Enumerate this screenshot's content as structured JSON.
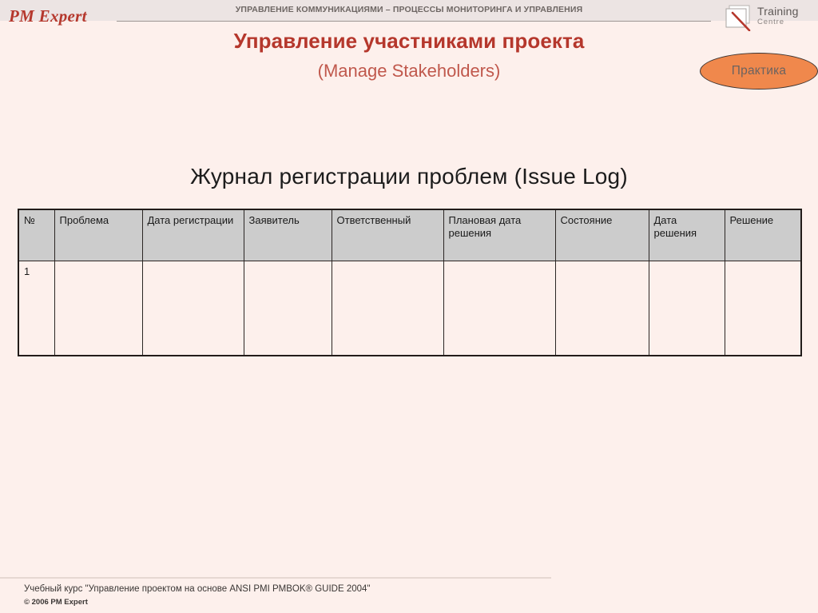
{
  "header": {
    "brand": "PM Expert",
    "kicker": "УПРАВЛЕНИЕ КОММУНИКАЦИЯМИ – ПРОЦЕССЫ МОНИТОРИНГА И УПРАВЛЕНИЯ",
    "training_centre": {
      "title": "Training",
      "subtitle": "Centre",
      "mark_icon": "page-with-red-slash-icon"
    }
  },
  "title": {
    "main": "Управление участниками проекта",
    "sub": "(Manage Stakeholders)"
  },
  "badge": {
    "label": "Практика"
  },
  "content": {
    "heading": "Журнал регистрации проблем (Issue Log)"
  },
  "table": {
    "columns": [
      "№",
      "Проблема",
      "Дата регистрации",
      "Заявитель",
      "Ответственный",
      "Плановая дата решения",
      "Состояние",
      "Дата решения",
      "Решение"
    ],
    "rows": [
      [
        "1",
        "",
        "",
        "",
        "",
        "",
        "",
        "",
        ""
      ]
    ]
  },
  "footer": {
    "course": "Учебный курс \"Управление проектом на основе ANSI PMI PMBOK® GUIDE 2004\"",
    "copyright": "© 2006 PM Expert"
  },
  "colors": {
    "background": "#fdf0ec",
    "header_band": "#ece4e3",
    "brand_red": "#b5372c",
    "title_red": "#b5372c",
    "subtitle_red": "#c0584c",
    "badge_orange": "#f0884c",
    "table_header_gray": "#cccccc",
    "table_border": "#2b2624"
  }
}
